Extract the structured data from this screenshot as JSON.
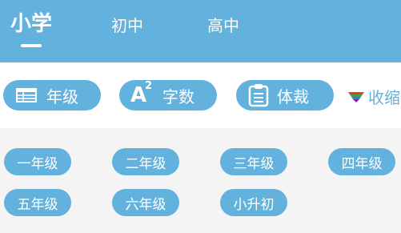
{
  "tabs": [
    {
      "label": "小学",
      "active": true
    },
    {
      "label": "初中",
      "active": false
    },
    {
      "label": "高中",
      "active": false
    }
  ],
  "filters": [
    {
      "label": "年级",
      "icon": "table-icon"
    },
    {
      "label": "字数",
      "icon": "a-squared-icon",
      "icon_text": "A",
      "icon_sup": "2"
    },
    {
      "label": "体裁",
      "icon": "clipboard-icon"
    }
  ],
  "collapse": {
    "label": "收缩",
    "icon": "rainbow-triangle-icon"
  },
  "grades": [
    "一年级",
    "二年级",
    "三年级",
    "四年级",
    "五年级",
    "六年级",
    "小升初"
  ],
  "colors": {
    "accent": "#63b2dd",
    "background": "#f4f4f4",
    "white": "#ffffff"
  }
}
